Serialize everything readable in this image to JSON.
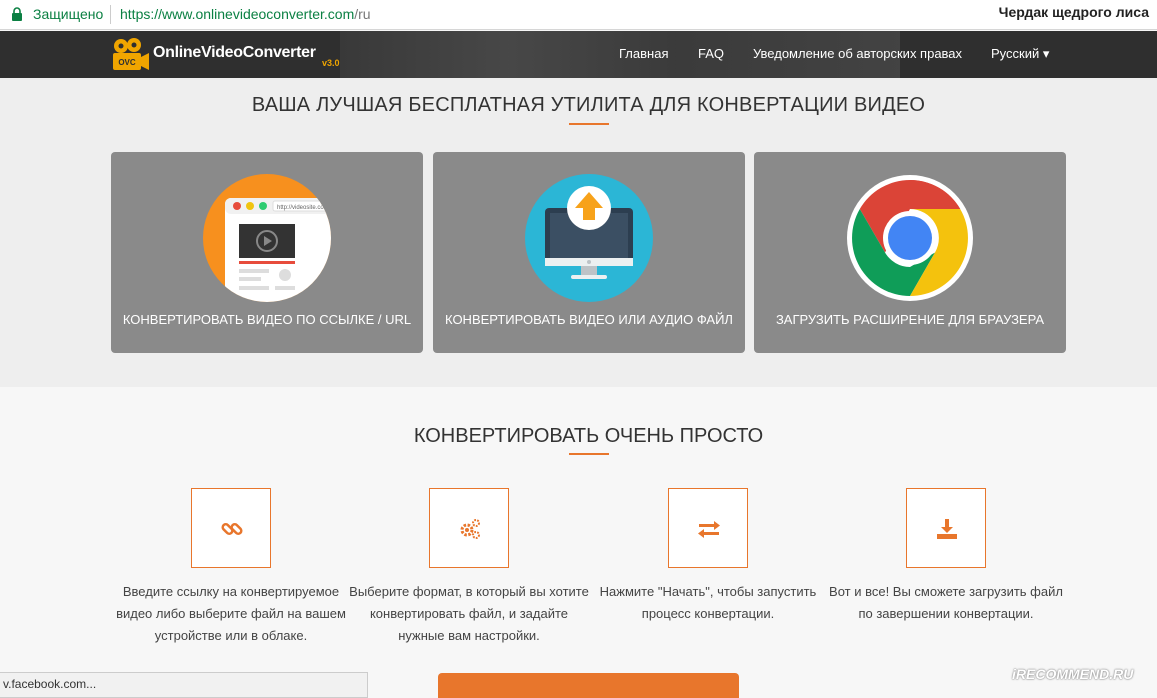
{
  "browser": {
    "secure_label": "Защищено",
    "url_host": "https://www.onlinevideoconverter.com",
    "url_path": "/ru",
    "profile_name": "Чердак щедрого лиса"
  },
  "header": {
    "logo_text": "OnlineVideoConverter",
    "logo_badge": "OVC",
    "logo_version": "v3.0",
    "nav": {
      "home": "Главная",
      "faq": "FAQ",
      "copyright": "Уведомление об авторских правах",
      "language": "Русский ▾"
    }
  },
  "hero": {
    "title": "ВАША ЛУЧШАЯ БЕСПЛАТНАЯ УТИЛИТА ДЛЯ КОНВЕРТАЦИИ ВИДЕО",
    "cards": [
      {
        "label": "КОНВЕРТИРОВАТЬ ВИДЕО ПО ССЫЛКЕ / URL",
        "icon": "browser-video-icon",
        "url_snippet": "http://videosite.com"
      },
      {
        "label": "КОНВЕРТИРОВАТЬ ВИДЕО ИЛИ АУДИО ФАЙЛ",
        "icon": "monitor-upload-icon"
      },
      {
        "label": "ЗАГРУЗИТЬ РАСШИРЕНИЕ ДЛЯ БРАУЗЕРА",
        "icon": "chrome-icon"
      }
    ]
  },
  "steps": {
    "title": "КОНВЕРТИРОВАТЬ ОЧЕНЬ ПРОСТО",
    "items": [
      {
        "icon": "link-icon",
        "text": "Введите ссылку на конвертируемое видео либо выберите файл на вашем устройстве или в облаке."
      },
      {
        "icon": "gears-icon",
        "text": "Выберите формат, в который вы хотите конвертировать файл, и задайте нужные вам настройки."
      },
      {
        "icon": "exchange-icon",
        "text": "Нажмите \"Начать\", чтобы запустить процесс конвертации."
      },
      {
        "icon": "download-icon",
        "text": "Вот и все! Вы сможете загрузить файл по завершении конвертации."
      }
    ]
  },
  "status_bar": "v.facebook.com...",
  "watermark": "iRECOMMEND.RU",
  "colors": {
    "accent": "#e8762c",
    "header_bg": "#2f2f2f",
    "card_bg": "#8a8a8a"
  }
}
